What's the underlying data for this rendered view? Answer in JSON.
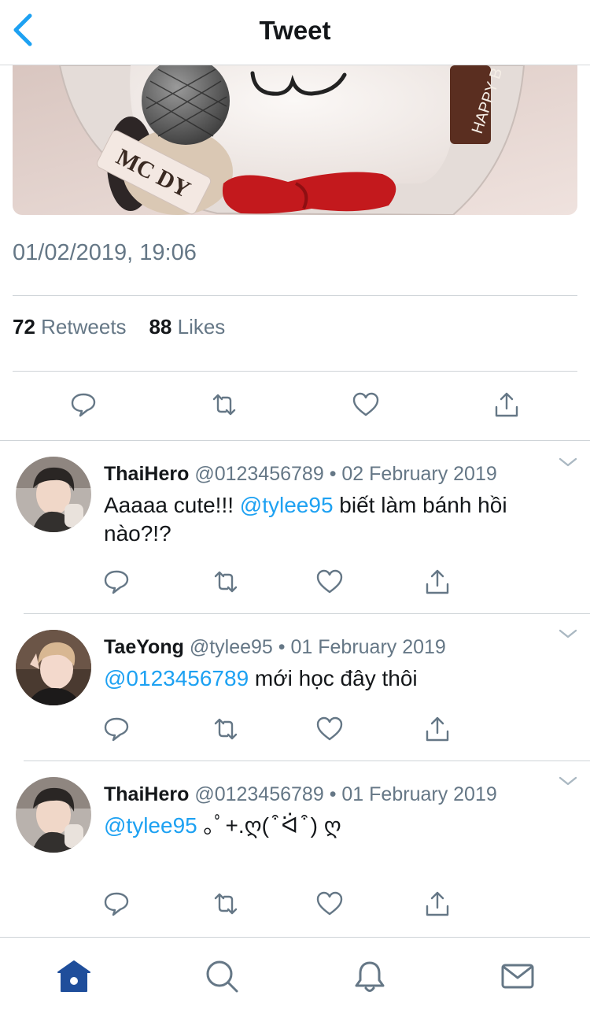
{
  "header": {
    "title": "Tweet",
    "back_icon": "chevron-left-icon"
  },
  "media": {
    "cake_plaque_text": "MC DY",
    "cake_ribbon_text": "HAPPY B"
  },
  "tweet": {
    "timestamp": "01/02/2019, 19:06",
    "retweets_count": "72",
    "retweets_label": "Retweets",
    "likes_count": "88",
    "likes_label": "Likes"
  },
  "actions": {
    "reply": "reply-icon",
    "retweet": "retweet-icon",
    "like": "heart-icon",
    "share": "share-icon"
  },
  "replies": [
    {
      "name": "ThaiHero",
      "handle": "@0123456789",
      "sep": "•",
      "date": "02 February 2019",
      "mention": "@tylee95",
      "text_before": "Aaaaa cute!!! ",
      "text_after": " biết làm bánh hồi nào?!?"
    },
    {
      "name": "TaeYong",
      "handle": "@tylee95",
      "sep": "•",
      "date": "01 February 2019",
      "mention": "@0123456789",
      "text_after": " mới học đây thôi"
    },
    {
      "name": "ThaiHero",
      "handle": "@0123456789",
      "sep": "•",
      "date": "01 February 2019",
      "mention": "@tylee95",
      "text_after": " ｡ﾟ+.ღ( ͒ ᐛ ͒ ) ღ"
    }
  ],
  "tabbar": {
    "home": "home-icon",
    "search": "search-icon",
    "notifications": "bell-icon",
    "messages": "mail-icon"
  },
  "colors": {
    "accent": "#1da1f2",
    "text": "#14171a",
    "secondary": "#657786",
    "active_tab": "#1f4e9b"
  }
}
